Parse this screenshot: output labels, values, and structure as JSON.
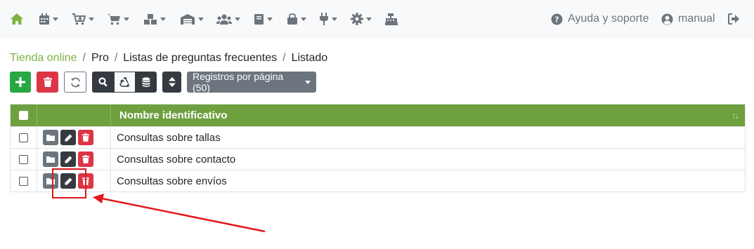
{
  "navbar": {
    "menu_icons": [
      "home-icon",
      "calendar-icon",
      "cart-plus-icon",
      "shopping-cart-icon",
      "cubes-icon",
      "warehouse-icon",
      "users-icon",
      "book-icon",
      "shopping-bag-icon",
      "plug-icon",
      "cog-icon",
      "cash-register-icon"
    ],
    "help_label": "Ayuda y soporte",
    "user_label": "manual",
    "accent_color": "#7cb342"
  },
  "breadcrumb": {
    "items": [
      "Tienda online",
      "Pro",
      "Listas de preguntas frecuentes",
      "Listado"
    ],
    "separator": "/"
  },
  "toolbar": {
    "records_per_page_label": "Registros por página (50)",
    "buttons": [
      "add-icon",
      "delete-icon",
      "refresh-icon",
      "search-icon",
      "recycle-icon",
      "database-icon",
      "sort-icon"
    ]
  },
  "table": {
    "header_color": "#6ea03f",
    "columns": [
      "Nombre identificativo"
    ],
    "rows": [
      {
        "name": "Consultas sobre tallas"
      },
      {
        "name": "Consultas sobre contacto"
      },
      {
        "name": "Consultas sobre envíos"
      }
    ]
  },
  "annotation": {
    "highlight_color": "#e0191b",
    "target": "edit-button-row-3"
  }
}
